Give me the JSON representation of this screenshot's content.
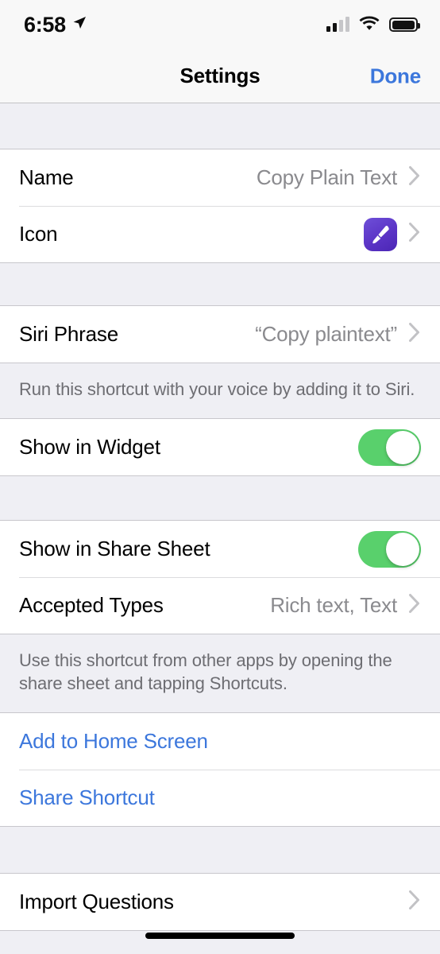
{
  "status_bar": {
    "time": "6:58",
    "location_icon": "location-arrow-icon",
    "cellular_icon": "cellular-signal-icon",
    "wifi_icon": "wifi-icon",
    "battery_icon": "battery-full-icon"
  },
  "nav": {
    "title": "Settings",
    "done_label": "Done"
  },
  "sections": {
    "identity": {
      "name_label": "Name",
      "name_value": "Copy Plain Text",
      "icon_label": "Icon",
      "icon_glyph": "paintbrush-icon"
    },
    "siri": {
      "phrase_label": "Siri Phrase",
      "phrase_value": "“Copy plaintext”",
      "footer": "Run this shortcut with your voice by adding it to Siri."
    },
    "widget": {
      "label": "Show in Widget",
      "value": "on"
    },
    "share": {
      "sheet_label": "Show in Share Sheet",
      "sheet_value": "on",
      "types_label": "Accepted Types",
      "types_value": "Rich text, Text",
      "footer": "Use this shortcut from other apps by opening the share sheet and tapping Shortcuts."
    },
    "actions": {
      "home_screen_label": "Add to Home Screen",
      "share_shortcut_label": "Share Shortcut"
    },
    "import": {
      "questions_label": "Import Questions"
    }
  },
  "colors": {
    "accent_blue": "#3C77DC",
    "toggle_green": "#59D06C",
    "icon_purple": "#5B34C6",
    "value_gray": "#8A8A8E",
    "group_background": "#EFEFF4"
  }
}
